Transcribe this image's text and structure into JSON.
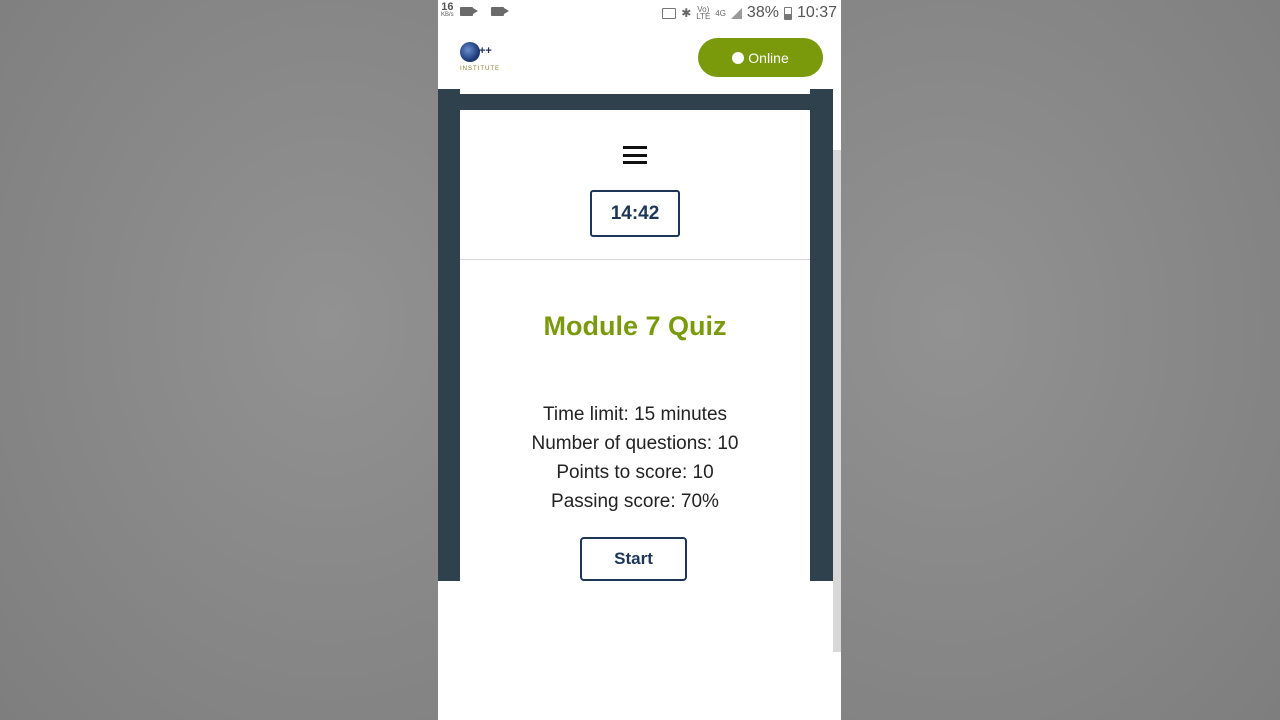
{
  "status_bar": {
    "data_speed": "16",
    "data_unit": "KB/s",
    "volte": "Vo) LTE",
    "network": "4G",
    "battery": "38%",
    "time": "10:37"
  },
  "header": {
    "logo_symbol": "++",
    "logo_text": "INSTITUTE",
    "online_label": "Online"
  },
  "quiz": {
    "timer": "14:42",
    "title": "Module 7 Quiz",
    "info": [
      "Time limit: 15 minutes",
      "Number of questions: 10",
      "Points to score: 10",
      "Passing score: 70%"
    ],
    "start_label": "Start"
  },
  "colors": {
    "accent_green": "#7a9a0c",
    "navy": "#1d3557",
    "frame": "#2f414d"
  },
  "icons": {
    "menu": "hamburger-menu-icon",
    "status": [
      "video-camera-icon",
      "video-record-icon",
      "cast-icon",
      "bluetooth-icon",
      "signal-icon",
      "battery-icon"
    ]
  }
}
